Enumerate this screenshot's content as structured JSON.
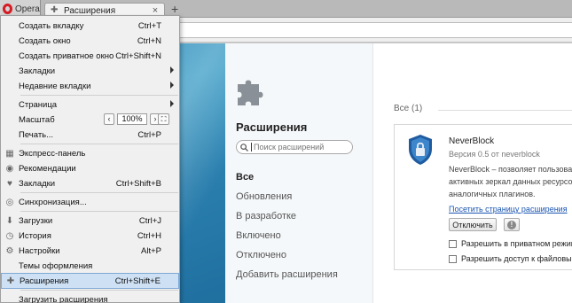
{
  "browser": {
    "menu_button_label": "Opera",
    "tab_title": "Расширения",
    "tab_close": "×",
    "new_tab": "+"
  },
  "extensions_page": {
    "title": "Расширения",
    "search_placeholder": "Поиск расширений",
    "filters": [
      {
        "label": "Все"
      },
      {
        "label": "Обновления"
      },
      {
        "label": "В разработке"
      },
      {
        "label": "Включено"
      },
      {
        "label": "Отключено"
      },
      {
        "label": "Добавить расширения"
      }
    ],
    "count_label": "Все (1)",
    "extension": {
      "name": "NeverBlock",
      "version": "Версия 0.5 от neverblock",
      "description_lines": [
        "NeverBlock – позволяет пользоватe",
        "активных зеркал данных ресурсов",
        "аналогичных плагинов."
      ],
      "page_link": "Посетить страницу расширения",
      "disable_button": "Отключить",
      "warn_symbol": "!",
      "options": [
        {
          "label": "Разрешить в приватном режим"
        },
        {
          "label": "Разрешить доступ к файловым"
        }
      ]
    }
  },
  "menu": {
    "items": [
      {
        "label": "Создать вкладку",
        "shortcut": "Ctrl+T"
      },
      {
        "label": "Создать окно",
        "shortcut": "Ctrl+N"
      },
      {
        "label": "Создать приватное окно",
        "shortcut": "Ctrl+Shift+N"
      },
      {
        "label": "Закладки",
        "shortcut": ""
      },
      {
        "label": "Недавние вкладки",
        "shortcut": ""
      },
      {
        "label": "Страница",
        "shortcut": ""
      },
      {
        "label": "Масштаб",
        "shortcut": ""
      },
      {
        "label": "Печать...",
        "shortcut": "Ctrl+P"
      },
      {
        "label": "Экспресс-панель",
        "shortcut": ""
      },
      {
        "label": "Рекомендации",
        "shortcut": ""
      },
      {
        "label": "Закладки",
        "shortcut": "Ctrl+Shift+B"
      },
      {
        "label": "Синхронизация...",
        "shortcut": ""
      },
      {
        "label": "Загрузки",
        "shortcut": "Ctrl+J"
      },
      {
        "label": "История",
        "shortcut": "Ctrl+H"
      },
      {
        "label": "Настройки",
        "shortcut": "Alt+P"
      },
      {
        "label": "Темы оформления",
        "shortcut": ""
      },
      {
        "label": "Расширения",
        "shortcut": "Ctrl+Shift+E"
      },
      {
        "label": "Загрузить расширения",
        "shortcut": ""
      }
    ],
    "zoom": {
      "minus": "‹",
      "value": "100%",
      "plus": "›",
      "fullscreen": "⛶"
    }
  },
  "colors": {
    "accent_highlight": "#cde0f4",
    "link": "#1a55b3",
    "opera_red": "#d51b24"
  }
}
